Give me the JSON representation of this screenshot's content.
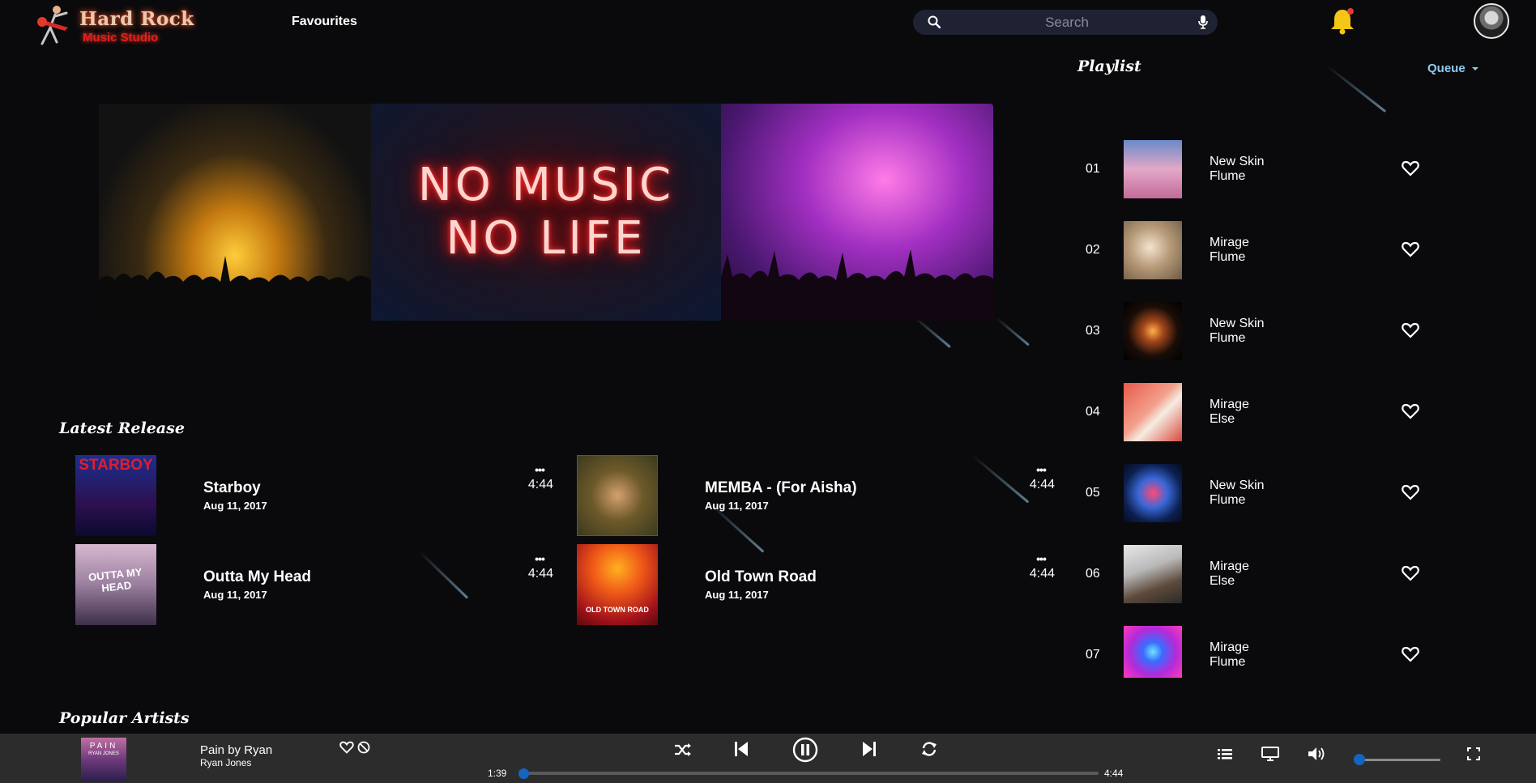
{
  "brand": {
    "title": "Hard Rock",
    "subtitle": "Music Studio"
  },
  "nav": {
    "favourites_label": "Favourites"
  },
  "search": {
    "placeholder": "Search"
  },
  "banner": {
    "neon_line1": "NO MUSIC",
    "neon_line2": "NO LIFE"
  },
  "latest": {
    "title": "Latest Release",
    "items": [
      {
        "title": "Starboy",
        "date": "Aug 11, 2017",
        "duration": "4:44",
        "more": "•••",
        "cover_text": "STARBOY"
      },
      {
        "title": "MEMBA - (For Aisha)",
        "date": "Aug 11, 2017",
        "duration": "4:44",
        "more": "•••",
        "cover_text": ""
      },
      {
        "title": "Outta My Head",
        "date": "Aug 11, 2017",
        "duration": "4:44",
        "more": "•••",
        "cover_text": "OUTTA MY HEAD"
      },
      {
        "title": "Old Town Road",
        "date": "Aug 11, 2017",
        "duration": "4:44",
        "more": "•••",
        "cover_text": "OLD TOWN ROAD"
      }
    ]
  },
  "popular": {
    "title": "Popular Artists"
  },
  "playlist": {
    "title": "Playlist",
    "queue_label": "Queue",
    "tracks": [
      {
        "num": "01",
        "title": "New Skin",
        "artist": "Flume"
      },
      {
        "num": "02",
        "title": "Mirage",
        "artist": "Flume"
      },
      {
        "num": "03",
        "title": "New Skin",
        "artist": "Flume"
      },
      {
        "num": "04",
        "title": "Mirage",
        "artist": "Else"
      },
      {
        "num": "05",
        "title": "New Skin",
        "artist": "Flume"
      },
      {
        "num": "06",
        "title": "Mirage",
        "artist": "Else"
      },
      {
        "num": "07",
        "title": "Mirage",
        "artist": "Flume"
      }
    ]
  },
  "player": {
    "title": "Pain by Ryan",
    "artist": "Ryan Jones",
    "cover_text": "PAIN",
    "cover_subtext": "RYAN JONES",
    "elapsed": "1:39",
    "total": "4:44",
    "progress_fraction": 0.0,
    "volume_fraction": 0.0
  },
  "colors": {
    "background": "#0a0a0c",
    "accent": "#1565c0",
    "queue": "#8ecbf2",
    "bell": "#f5c518",
    "player_bar": "#2c2c2c"
  },
  "icons": [
    "search-icon",
    "mic-icon",
    "bell-icon",
    "heart-icon",
    "block-icon",
    "shuffle-icon",
    "previous-icon",
    "pause-icon",
    "next-icon",
    "repeat-icon",
    "queue-list-icon",
    "device-icon",
    "volume-icon",
    "fullscreen-icon",
    "chevron-down-icon"
  ]
}
